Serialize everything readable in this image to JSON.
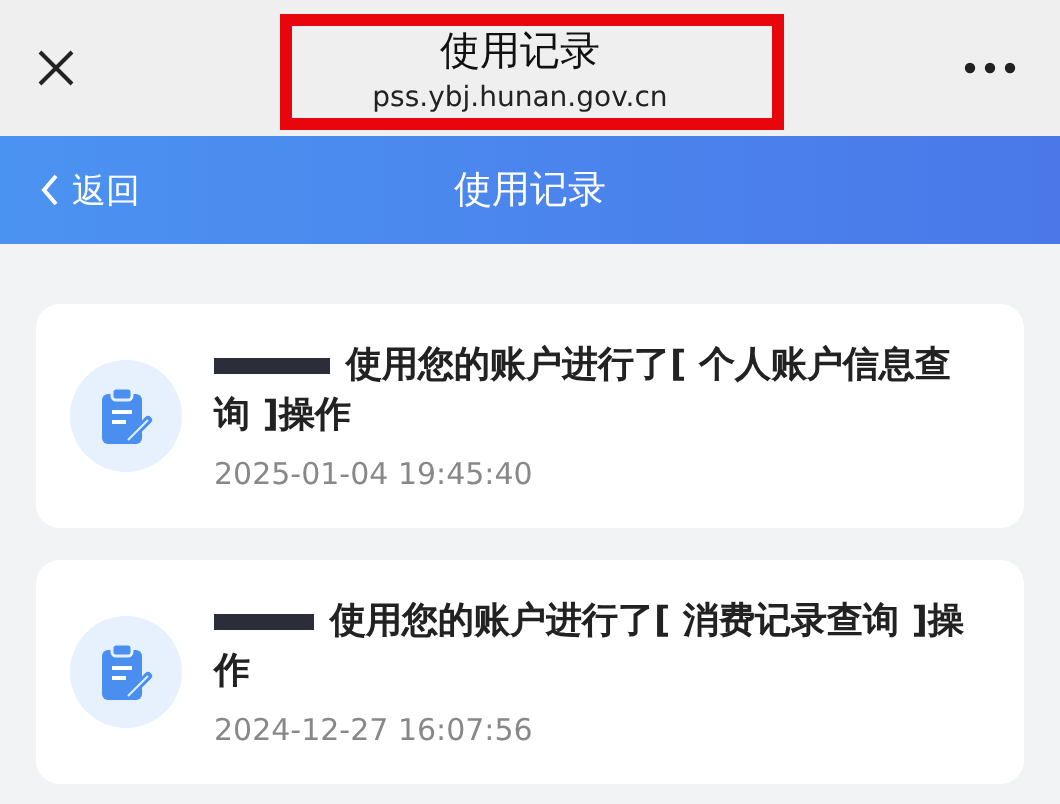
{
  "browser_bar": {
    "title": "使用记录",
    "url": "pss.ybj.hunan.gov.cn",
    "highlighted": true
  },
  "header": {
    "back_label": "返回",
    "title": "使用记录"
  },
  "records": [
    {
      "redacted": true,
      "text": "使用您的账户进行了[ 个人账户信息查询 ]操作",
      "time": "2025-01-04 19:45:40"
    },
    {
      "redacted": true,
      "text": "使用您的账户进行了[ 消费记录查询 ]操作",
      "time": "2024-12-27 16:07:56"
    }
  ]
}
